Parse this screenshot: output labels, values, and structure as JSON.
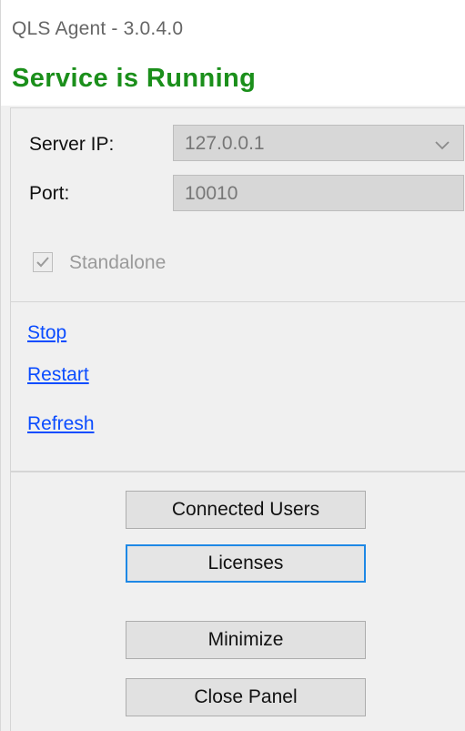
{
  "window": {
    "title": "QLS Agent - 3.0.4.0"
  },
  "status": {
    "text": "Service is Running",
    "color": "#1b8f1b"
  },
  "settings": {
    "server_ip_label": "Server IP:",
    "server_ip_value": "127.0.0.1",
    "port_label": "Port:",
    "port_value": "10010",
    "standalone_label": "Standalone",
    "standalone_checked": true
  },
  "actions": {
    "stop": "Stop",
    "restart": "Restart",
    "refresh": "Refresh"
  },
  "buttons": {
    "connected_users": "Connected Users",
    "licenses": "Licenses",
    "minimize": "Minimize",
    "close_panel": "Close Panel"
  },
  "colors": {
    "link": "#0a4cff",
    "focus": "#1e88e5",
    "panel_bg": "#f0f0f0"
  },
  "icons": {
    "dropdown": "chevron-down-icon",
    "checkbox": "check-icon"
  }
}
